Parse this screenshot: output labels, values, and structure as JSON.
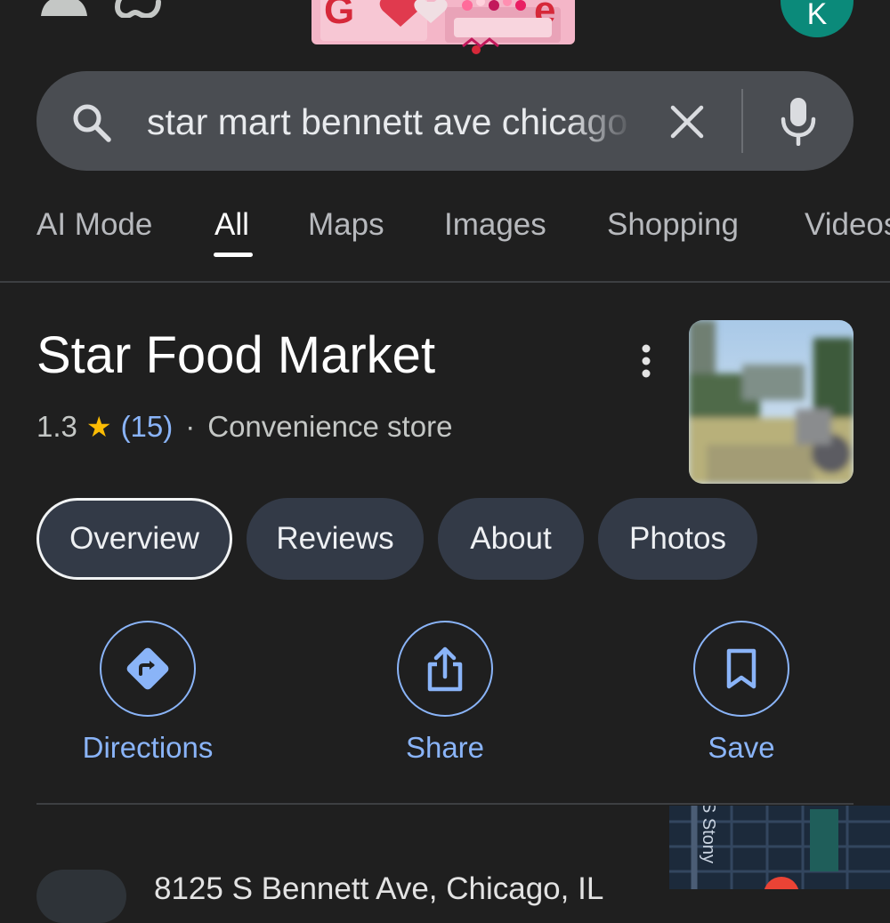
{
  "header": {
    "avatar_letter": "K",
    "doodle_text": "Google",
    "colors": {
      "avatar": "#0b8a7a",
      "background": "#1f1f1f"
    }
  },
  "search": {
    "query": "star mart bennett ave chicago",
    "icons": [
      "search-icon",
      "clear-icon",
      "microphone-icon"
    ]
  },
  "tabs": [
    {
      "label": "AI Mode",
      "active": false
    },
    {
      "label": "All",
      "active": true
    },
    {
      "label": "Maps",
      "active": false
    },
    {
      "label": "Images",
      "active": false
    },
    {
      "label": "Shopping",
      "active": false
    },
    {
      "label": "Videos",
      "active": false
    }
  ],
  "place": {
    "name": "Star Food Market",
    "rating": "1.3",
    "star_glyph": "★",
    "review_count": "(15)",
    "separator": "·",
    "category": "Convenience store",
    "accent_color": "#8ab4f8",
    "star_color": "#fbbc04"
  },
  "chips": [
    {
      "label": "Overview",
      "selected": true
    },
    {
      "label": "Reviews",
      "selected": false
    },
    {
      "label": "About",
      "selected": false
    },
    {
      "label": "Photos",
      "selected": false
    }
  ],
  "actions": [
    {
      "label": "Directions",
      "icon": "directions-icon"
    },
    {
      "label": "Share",
      "icon": "share-icon"
    },
    {
      "label": "Save",
      "icon": "bookmark-icon"
    }
  ],
  "address": {
    "text": "8125 S Bennett Ave, Chicago, IL"
  },
  "map": {
    "street_label": "S Stony"
  }
}
